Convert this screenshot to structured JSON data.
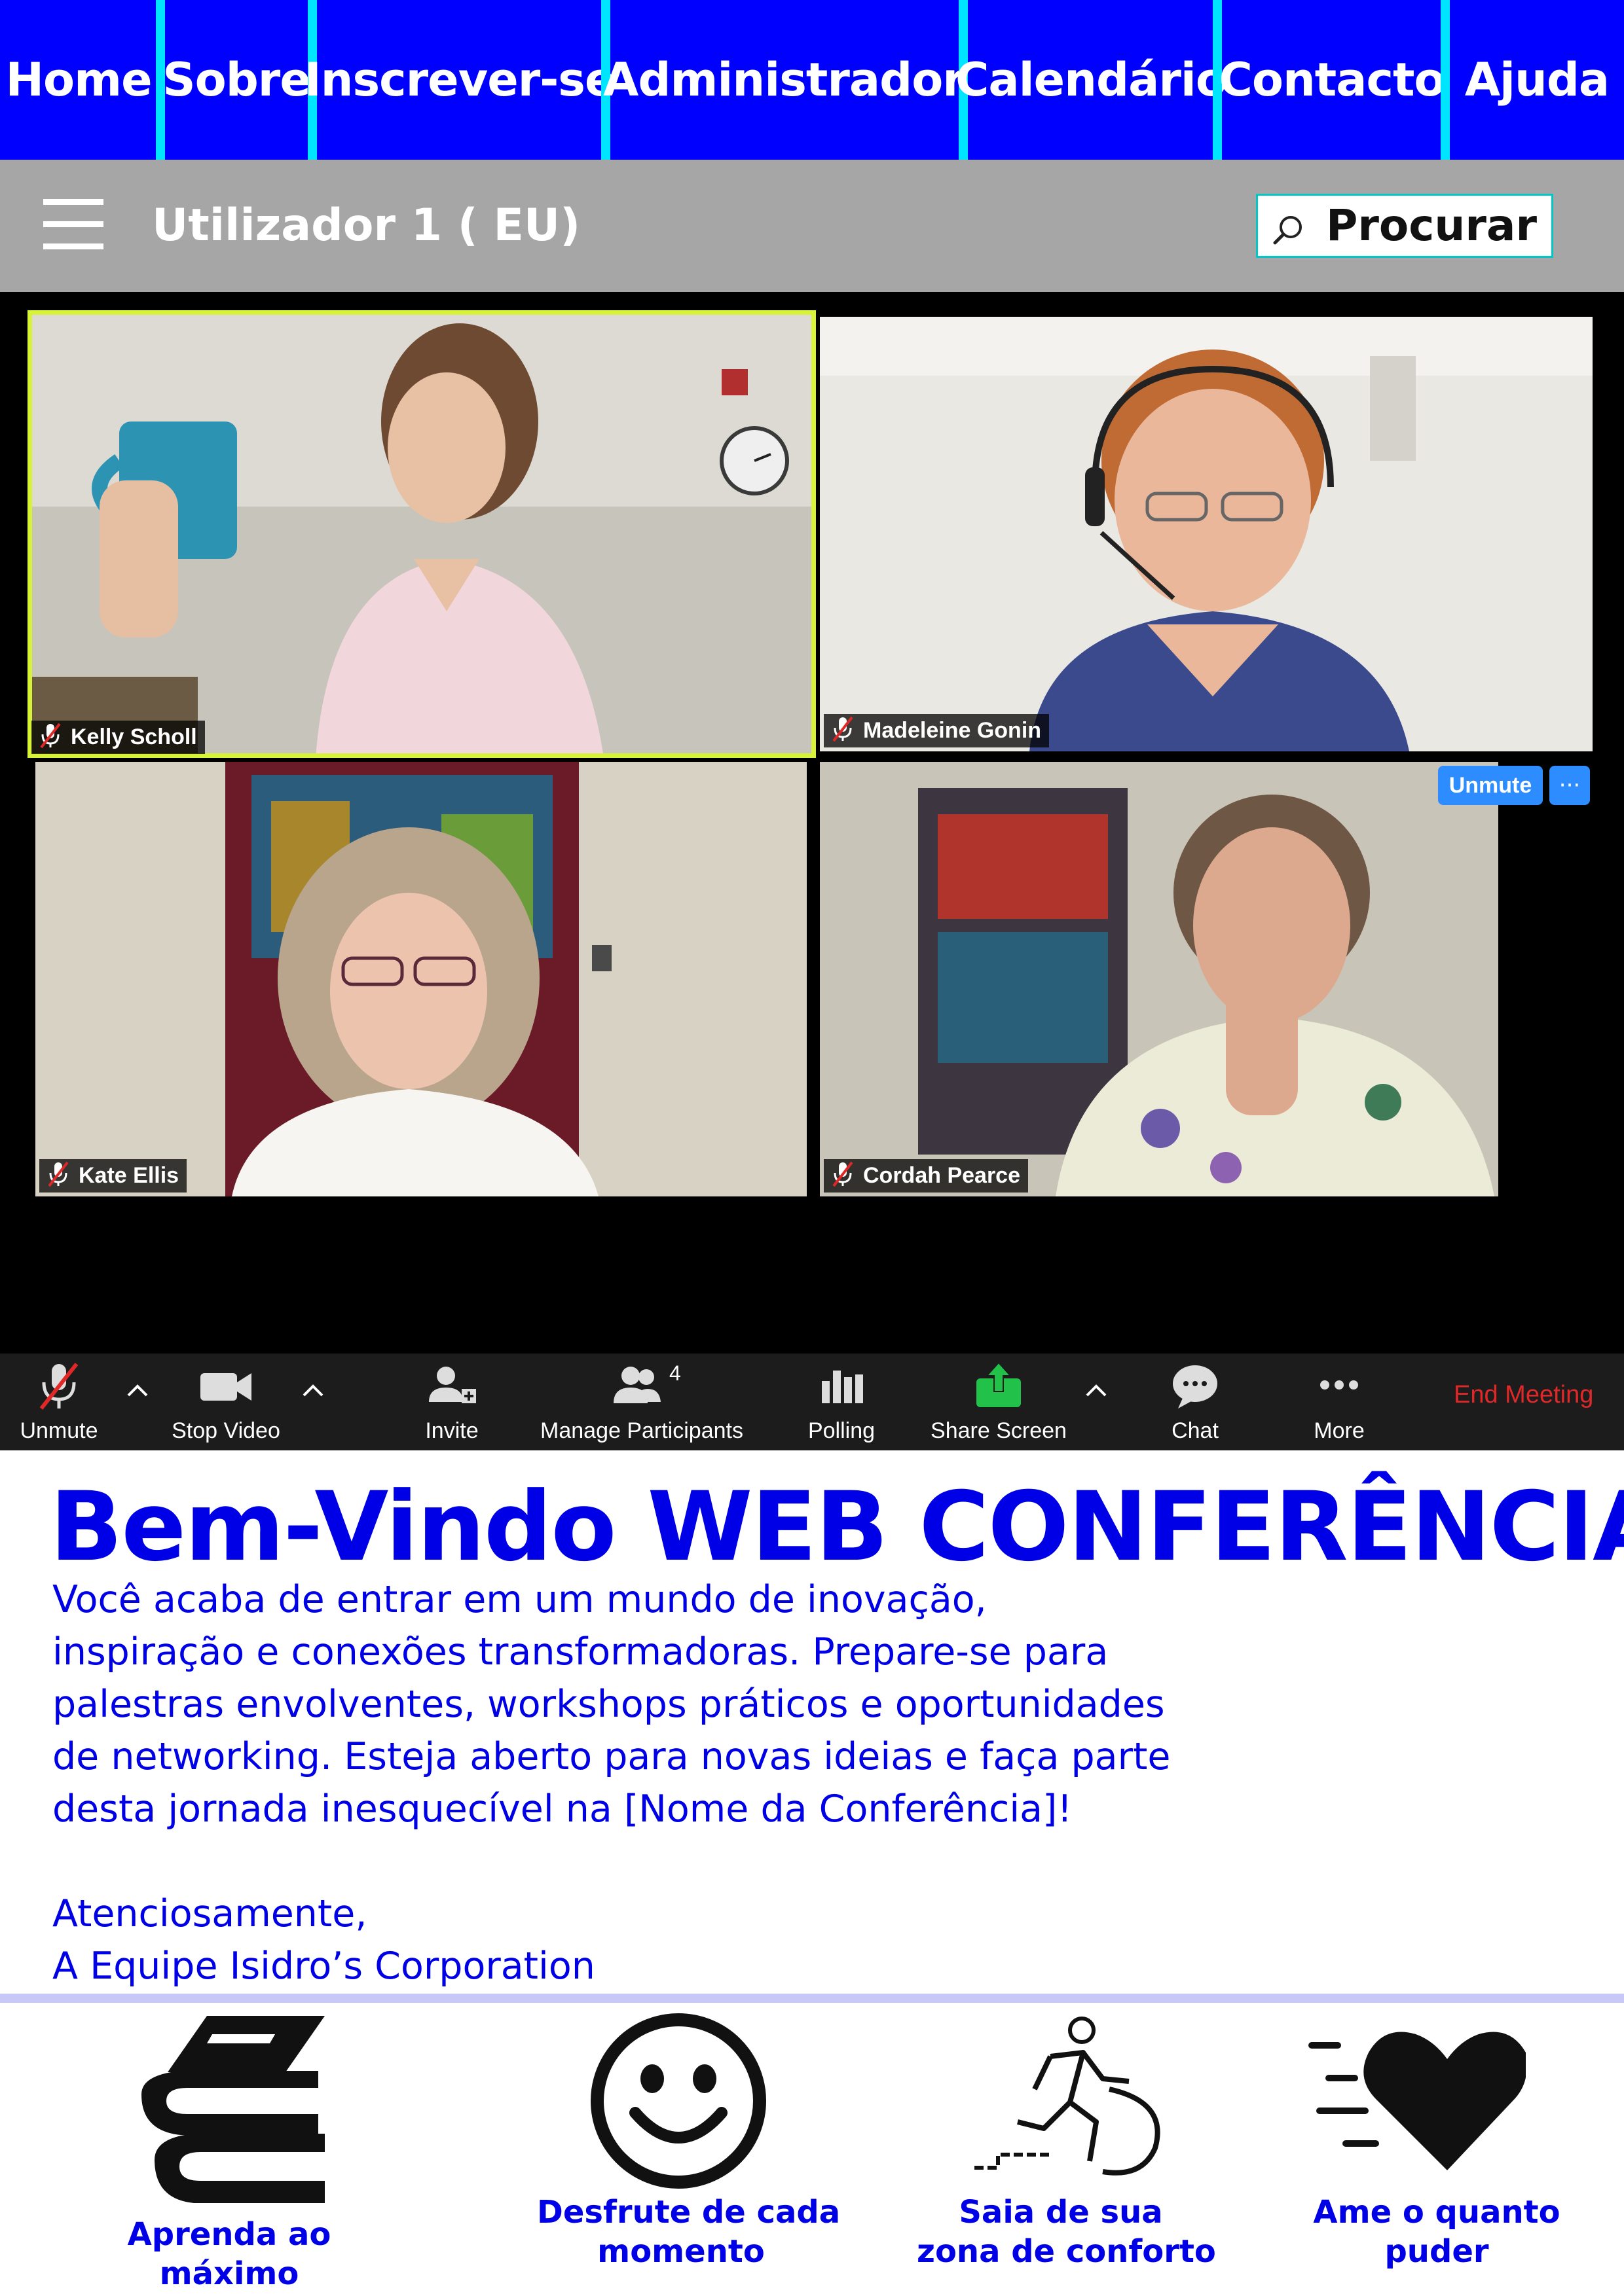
{
  "nav": {
    "items": [
      "Home",
      "Sobre",
      "Inscrever-se",
      "Administrador",
      "Calendário",
      "Contacto",
      "Ajuda"
    ],
    "background": "#0000ff",
    "separator_color": "#00e5ff"
  },
  "userbar": {
    "menu_icon": "hamburger-menu-icon",
    "user_label": "Utilizador 1 ( EU)",
    "search_icon": "search-icon",
    "search_label": "Procurar"
  },
  "conference": {
    "participants": [
      {
        "name": "Kelly Scholl",
        "active_speaker": true
      },
      {
        "name": "Madeleine Gonin",
        "active_speaker": false
      },
      {
        "name": "Kate Ellis",
        "active_speaker": false
      },
      {
        "name": "Cordah Pearce",
        "active_speaker": false
      }
    ],
    "unmute_button": "Unmute",
    "more_button": "···",
    "toolbar": {
      "unmute": "Unmute",
      "stop_video": "Stop Video",
      "invite": "Invite",
      "manage_participants": "Manage Participants",
      "participant_count": "4",
      "polling": "Polling",
      "share_screen": "Share Screen",
      "chat": "Chat",
      "more": "More",
      "end_meeting": "End Meeting"
    }
  },
  "welcome": {
    "title": "Bem-Vindo WEB CONFERÊNCIA",
    "body_lines": [
      "Você acaba de entrar em um mundo de inovação,",
      "inspiração e conexões transformadoras. Prepare-se para",
      "palestras envolventes, workshops práticos e oportunidades",
      "de networking. Esteja aberto para novas ideias e faça parte",
      "desta jornada inesquecível na [Nome da Conferência]!"
    ],
    "closing": "Atenciosamente,",
    "signature": "A Equipe Isidro’s Corporation"
  },
  "features": [
    {
      "icon": "books-icon",
      "line1": "Aprenda ao",
      "line2": "máximo"
    },
    {
      "icon": "smiley-face-icon",
      "line1": "Desfrute de cada",
      "line2": "momento"
    },
    {
      "icon": "running-person-icon",
      "line1": "Saia de sua",
      "line2": "zona de conforto"
    },
    {
      "icon": "heart-icon",
      "line1": "Ame o quanto",
      "line2": "puder"
    }
  ]
}
